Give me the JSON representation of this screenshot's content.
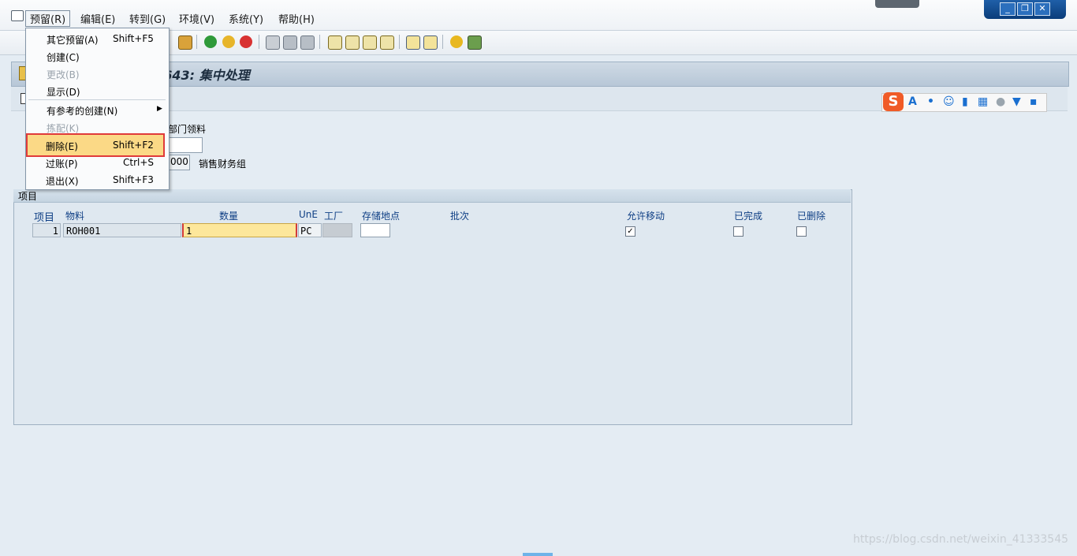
{
  "menubar": {
    "items": [
      {
        "label": "预留(R)"
      },
      {
        "label": "编辑(E)"
      },
      {
        "label": "转到(G)"
      },
      {
        "label": "环境(V)"
      },
      {
        "label": "系统(Y)"
      },
      {
        "label": "帮助(H)"
      }
    ]
  },
  "dropdown": {
    "items": [
      {
        "label": "其它预留(A)",
        "shortcut": "Shift+F5"
      },
      {
        "label": "创建(C)",
        "shortcut": ""
      },
      {
        "label": "更改(B)",
        "shortcut": ""
      },
      {
        "label": "显示(D)",
        "shortcut": ""
      },
      {
        "label": "有参考的创建(N)",
        "shortcut": ""
      },
      {
        "label": "拣配(K)",
        "shortcut": ""
      },
      {
        "label": "删除(E)",
        "shortcut": "Shift+F2"
      },
      {
        "label": "过账(P)",
        "shortcut": "Ctrl+S"
      },
      {
        "label": "退出(X)",
        "shortcut": "Shift+F3"
      }
    ]
  },
  "title": "00643: 集中处理",
  "header": {
    "movement_text": "部门领料",
    "cost_center_value": "000",
    "cost_center_text": "销售财务组"
  },
  "items": {
    "caption": "项目",
    "columns": [
      "项目",
      "物料",
      "数量",
      "UnE",
      "工厂",
      "存储地点",
      "批次",
      "允许移动",
      "已完成",
      "已删除"
    ],
    "rows": [
      {
        "item": "1",
        "material": "ROH001",
        "quantity": "1",
        "unit": "PC",
        "plant": "",
        "storage": "",
        "batch": "",
        "allow_move": true,
        "completed": false,
        "deleted": false
      }
    ]
  },
  "watermark": "https://blog.csdn.net/weixin_41333545",
  "colors": {
    "highlight": "#fbd986",
    "highlight_border": "#e03a3a",
    "column_header": "#0f3f85"
  }
}
